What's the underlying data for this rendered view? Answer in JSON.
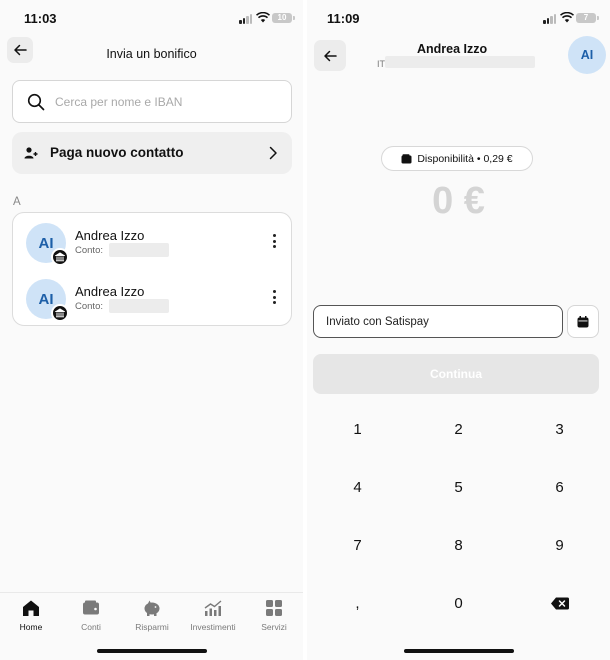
{
  "left": {
    "status": {
      "time": "11:03",
      "battery": "10"
    },
    "title": "Invia un bonifico",
    "search": {
      "placeholder": "Cerca per nome e IBAN",
      "value": ""
    },
    "new_contact": {
      "label": "Paga nuovo contatto"
    },
    "section_letter": "A",
    "contacts": [
      {
        "initials": "AI",
        "name": "Andrea Izzo",
        "account_label": "Conto:"
      },
      {
        "initials": "AI",
        "name": "Andrea Izzo",
        "account_label": "Conto:"
      }
    ],
    "tabs": [
      {
        "label": "Home",
        "icon": "home-icon",
        "active": true
      },
      {
        "label": "Conti",
        "icon": "wallet-icon",
        "active": false
      },
      {
        "label": "Risparmi",
        "icon": "piggy-bank-icon",
        "active": false
      },
      {
        "label": "Investimenti",
        "icon": "chart-up-icon",
        "active": false
      },
      {
        "label": "Servizi",
        "icon": "grid-icon",
        "active": false
      }
    ]
  },
  "right": {
    "status": {
      "time": "11:09",
      "battery": "7"
    },
    "recipient_name": "Andrea Izzo",
    "iban_prefix": "IT",
    "avatar_initials": "AI",
    "balance": {
      "label": "Disponibilità • 0,29 €"
    },
    "amount": "0 €",
    "memo": {
      "value": "Inviato con Satispay"
    },
    "continue_label": "Continua",
    "keypad": [
      "1",
      "2",
      "3",
      "4",
      "5",
      "6",
      "7",
      "8",
      "9",
      ",",
      "0"
    ]
  },
  "colors": {
    "avatar_bg": "#cfe3f7",
    "avatar_text": "#1d5fa8",
    "disabled_button": "#e6e6e6",
    "amount_placeholder": "#d4d4d4"
  }
}
